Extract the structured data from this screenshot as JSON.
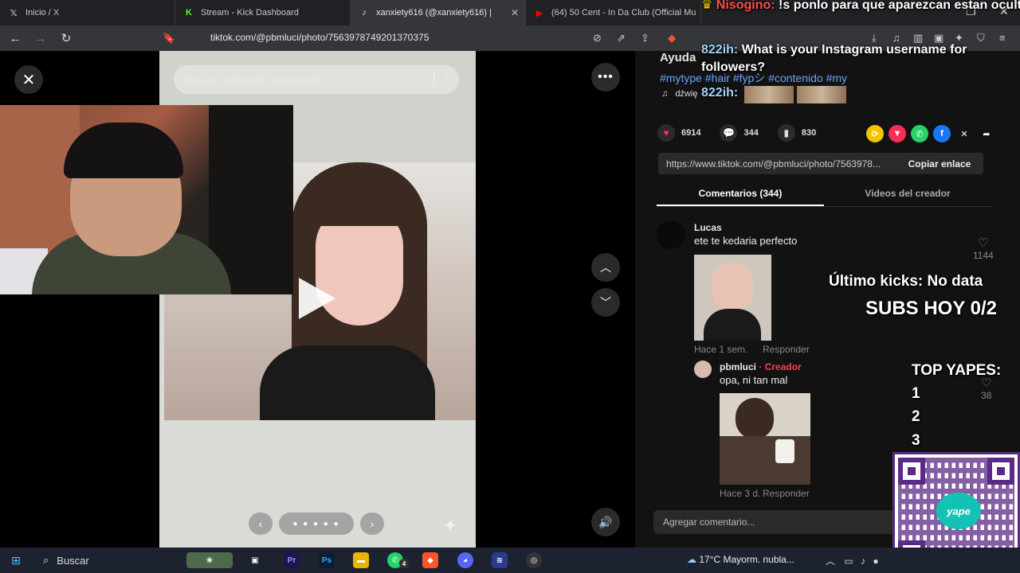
{
  "browser": {
    "tabs": [
      {
        "title": "Inicio / X",
        "icon": "x-logo-icon",
        "active": false
      },
      {
        "title": "Stream - Kick Dashboard",
        "icon": "kick-logo-icon",
        "active": false
      },
      {
        "title": "xanxiety616 (@xanxiety616) |",
        "icon": "tiktok-logo-icon",
        "active": true
      },
      {
        "title": "(64) 50 Cent - In Da Club (Official Mu",
        "icon": "youtube-logo-icon",
        "active": false
      }
    ],
    "url": "tiktok.com/@pbmluci/photo/7563978749201370375"
  },
  "viewer": {
    "search_placeholder": "Buscar contenido relacionado"
  },
  "panel": {
    "title": "Ayuda",
    "hashtags": "#mytype #hair #fypシ #contenido #my",
    "sound": "dźwię",
    "stats": {
      "likes": "6914",
      "comments": "344",
      "saves": "830"
    },
    "link": "https://www.tiktok.com/@pbmluci/photo/7563978...",
    "copy_label": "Copiar enlace",
    "tabs": [
      "Comentarios (344)",
      "Videos del creador"
    ],
    "comments": [
      {
        "user": "Lucas",
        "text": "ete te kedaria perfecto",
        "time": "Hace 1 sem.",
        "reply": "Responder",
        "likes": "1144"
      },
      {
        "user": "pbmluci",
        "badge": "Creador",
        "text": "opa, ni tan mal",
        "time": "Hace 3 d.",
        "reply": "Responder",
        "likes": "38"
      }
    ],
    "add_comment_placeholder": "Agregar comentario..."
  },
  "overlay": {
    "chat": [
      {
        "nick": "Nisogino:",
        "message": "!s ponlo para que aparezcan estan ocultos"
      },
      {
        "nick": "822ih:",
        "message": "What is your Instagram username for followers?"
      },
      {
        "nick": "822ih:",
        "message": ""
      }
    ],
    "last_kicks": "Último kicks: No data",
    "subs_today": "SUBS HOY 0/2",
    "top_yapes_title": "TOP YAPES:",
    "top_yapes": [
      "1",
      "2",
      "3"
    ],
    "qr_logo": "yape"
  },
  "taskbar": {
    "search": "Buscar",
    "weather": "17°C  Mayorm. nubla...",
    "whatsapp_badge": "4"
  },
  "colors": {
    "accent_link": "#6aa3ff",
    "creator_red": "#ff3b5c",
    "chat_nick_red": "#ff4d4d",
    "qr_purple": "#5b2a86"
  }
}
